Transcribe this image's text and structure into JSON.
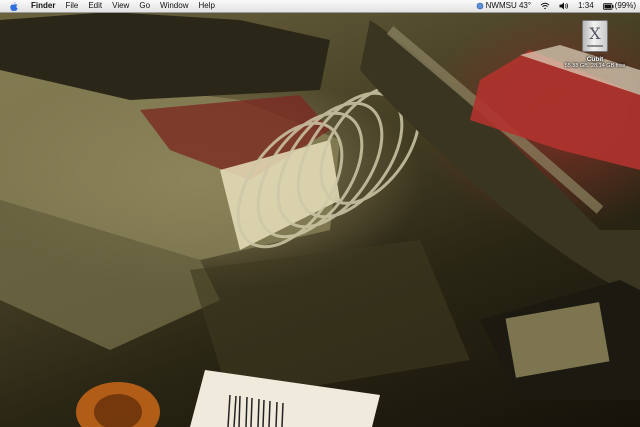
{
  "menubar": {
    "apple_icon": "apple-icon",
    "items": [
      {
        "label": "Finder",
        "bold": true
      },
      {
        "label": "File"
      },
      {
        "label": "Edit"
      },
      {
        "label": "View"
      },
      {
        "label": "Go"
      },
      {
        "label": "Window"
      },
      {
        "label": "Help"
      }
    ],
    "status": {
      "weather": "NWMSU 43°",
      "wifi_icon": "wifi-icon",
      "volume_icon": "volume-icon",
      "clock": "1:34",
      "battery_icon": "battery-icon",
      "battery_percent": "(99%)"
    }
  },
  "desktop": {
    "drive": {
      "icon": "hard-drive-icon",
      "label": "Cubit",
      "info": "55.88 GB, 28.14 GB free"
    }
  },
  "colors": {
    "menubar_bg": "#f2f2f2",
    "text": "#111111",
    "wallpaper_dark": "#15120a",
    "wallpaper_warm": "#6d6540",
    "wallpaper_red": "#aa2828"
  }
}
